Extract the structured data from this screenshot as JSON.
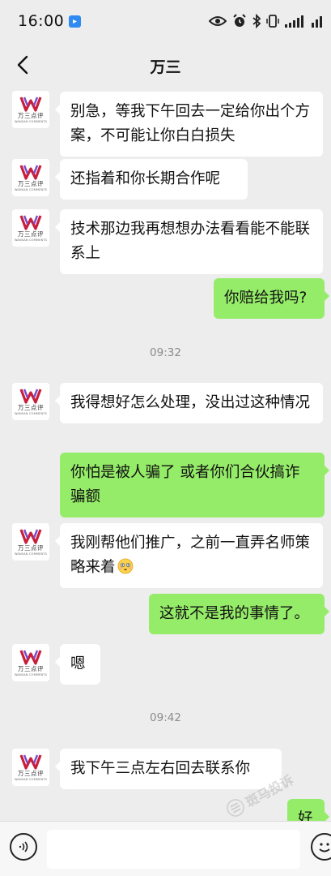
{
  "status_bar": {
    "time": "16:00"
  },
  "header": {
    "title": "万三"
  },
  "avatar": {
    "brand_cn": "万三点评",
    "brand_en": "WANSAN COMMENTS"
  },
  "messages": [
    {
      "dir": "in",
      "text": "别急，等我下午回去一定给你出个方案，不可能让你白白损失"
    },
    {
      "dir": "in",
      "text": "还指着和你长期合作呢"
    },
    {
      "dir": "in",
      "text": "技术那边我再想想办法看看能不能联系上"
    },
    {
      "dir": "out",
      "text": "你赔给我吗?"
    },
    {
      "dir": "time",
      "text": "09:32"
    },
    {
      "dir": "in",
      "text": "我得想好怎么处理，没出过这种情况"
    },
    {
      "dir": "out",
      "text": "你怕是被人骗了  或者你们合伙搞诈骗额"
    },
    {
      "dir": "in",
      "text": "我刚帮他们推广，之前一直弄名师策略来着"
    },
    {
      "dir": "out",
      "text": "这就不是我的事情了。"
    },
    {
      "dir": "in",
      "text": "嗯"
    },
    {
      "dir": "time",
      "text": "09:42"
    },
    {
      "dir": "in",
      "text": "我下午三点左右回去联系你"
    },
    {
      "dir": "out",
      "text": "好"
    }
  ],
  "watermark": {
    "text": "斑马投诉"
  },
  "input": {
    "value": "",
    "placeholder": ""
  },
  "colors": {
    "incoming": "#ffffff",
    "outgoing": "#95ec69",
    "background": "#ededed"
  },
  "icons": {
    "status": [
      "app-notification-icon",
      "eye-icon",
      "alarm-icon",
      "bluetooth-icon",
      "vibrate-icon",
      "signal-icon",
      "signal-icon"
    ],
    "nav": "back-arrow-icon",
    "input": [
      "voice-icon",
      "emoji-icon"
    ],
    "inline_emoji": "flushed-face-emoji"
  }
}
